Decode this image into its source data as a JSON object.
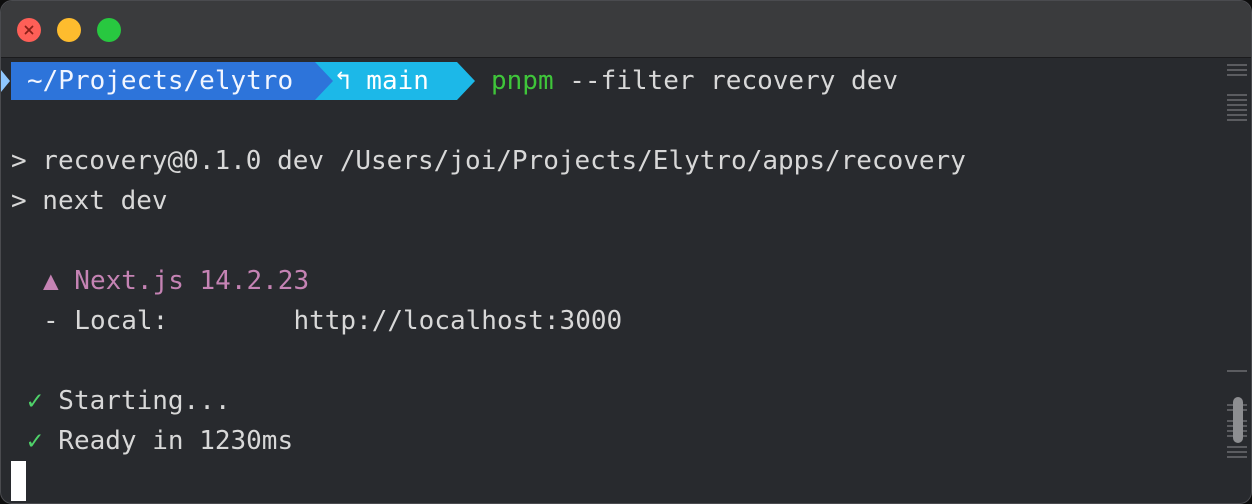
{
  "prompt": {
    "path": "~/Projects/elytro",
    "branch": "↰ main",
    "command_bin": "pnpm",
    "command_args": " --filter recovery dev"
  },
  "output": {
    "line1": "> recovery@0.1.0 dev /Users/joi/Projects/Elytro/apps/recovery",
    "line2": "> next dev",
    "next_version": "▲ Next.js 14.2.23",
    "local_label": "- Local:        ",
    "local_url": "http://localhost:3000",
    "check_glyph": "✓",
    "starting": " Starting...",
    "ready": " Ready in 1230ms"
  },
  "colors": {
    "path_segment": "#2d74da",
    "branch_segment": "#1cb8e8",
    "command_green": "#3fc53a",
    "nextjs_pink": "#c583b4",
    "check_green": "#4fd26a",
    "background": "#282a2e"
  }
}
